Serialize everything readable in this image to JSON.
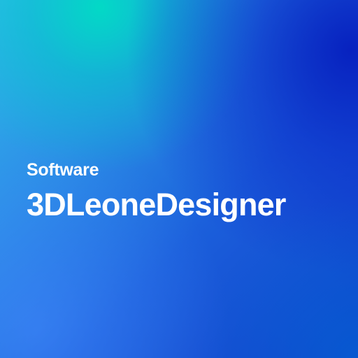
{
  "card": {
    "eyebrow": "Software",
    "title": "3DLeoneDesigner"
  },
  "colors": {
    "text": "#ffffff",
    "gradient_top_left_teal": "#00d6c4",
    "gradient_left": "#32b8ec",
    "gradient_center": "#1b5fdb",
    "gradient_top_right": "#061ebe",
    "gradient_bottom_right": "#006ed7"
  }
}
